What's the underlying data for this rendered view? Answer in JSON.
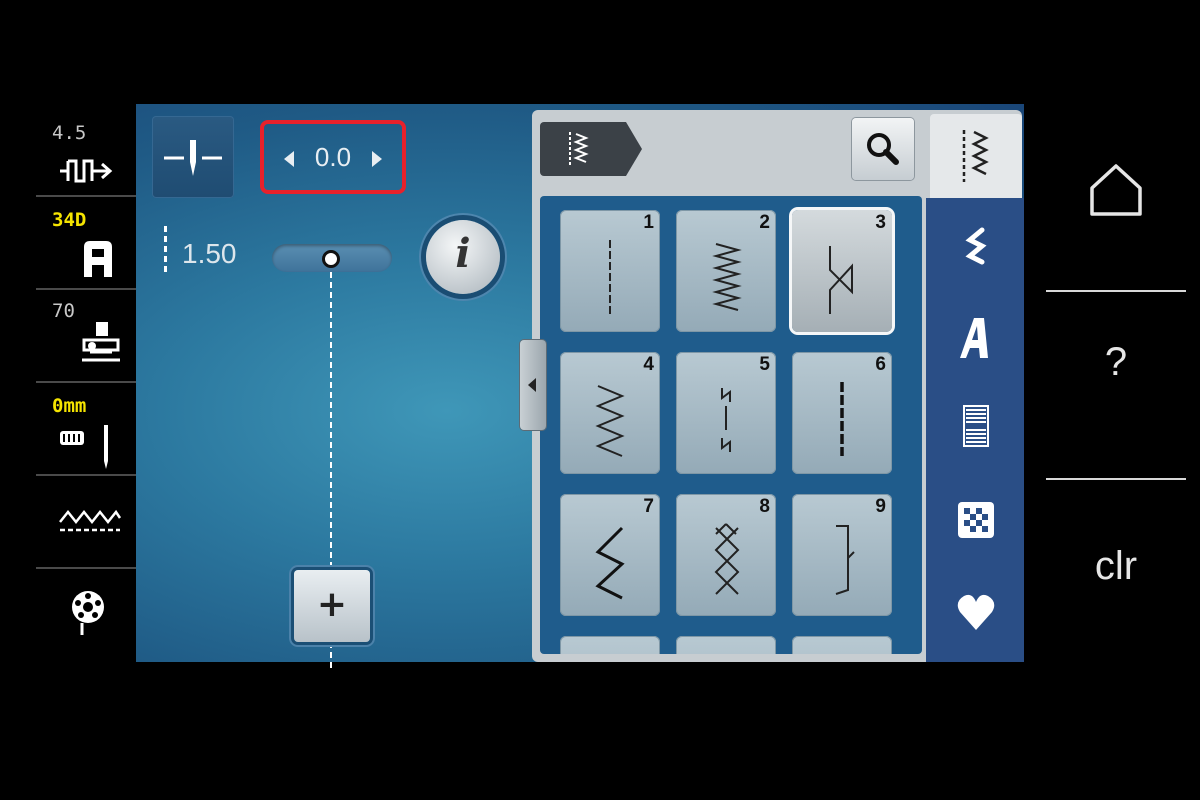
{
  "left_status": {
    "stitch_width": "4.5",
    "presser_foot": "34D",
    "needle": "70",
    "needle_position": "0mm"
  },
  "needle_position_control": {
    "value": "0.0"
  },
  "stitch_length": {
    "value": "1.50"
  },
  "stitch_grid": {
    "tiles": [
      {
        "number": "1",
        "icon": "straight-stitch-icon"
      },
      {
        "number": "2",
        "icon": "triple-zigzag-icon"
      },
      {
        "number": "3",
        "icon": "zigzag-icon",
        "selected": true
      },
      {
        "number": "4",
        "icon": "serpentine-stitch-icon"
      },
      {
        "number": "5",
        "icon": "securing-stitch-icon"
      },
      {
        "number": "6",
        "icon": "triple-straight-icon"
      },
      {
        "number": "7",
        "icon": "vari-overlock-icon"
      },
      {
        "number": "8",
        "icon": "honeycomb-stitch-icon"
      },
      {
        "number": "9",
        "icon": "blind-stitch-icon"
      }
    ]
  },
  "categories": [
    "practical-stitches-icon",
    "alphabets-icon",
    "buttonholes-icon",
    "quilt-stitches-icon",
    "favorites-heart-icon"
  ],
  "system": {
    "help_label": "?",
    "clear_label": "clr"
  },
  "colors": {
    "highlight": "#e8212b",
    "status_yellow": "#f5e400",
    "screen_blue": "#2c79a0"
  }
}
